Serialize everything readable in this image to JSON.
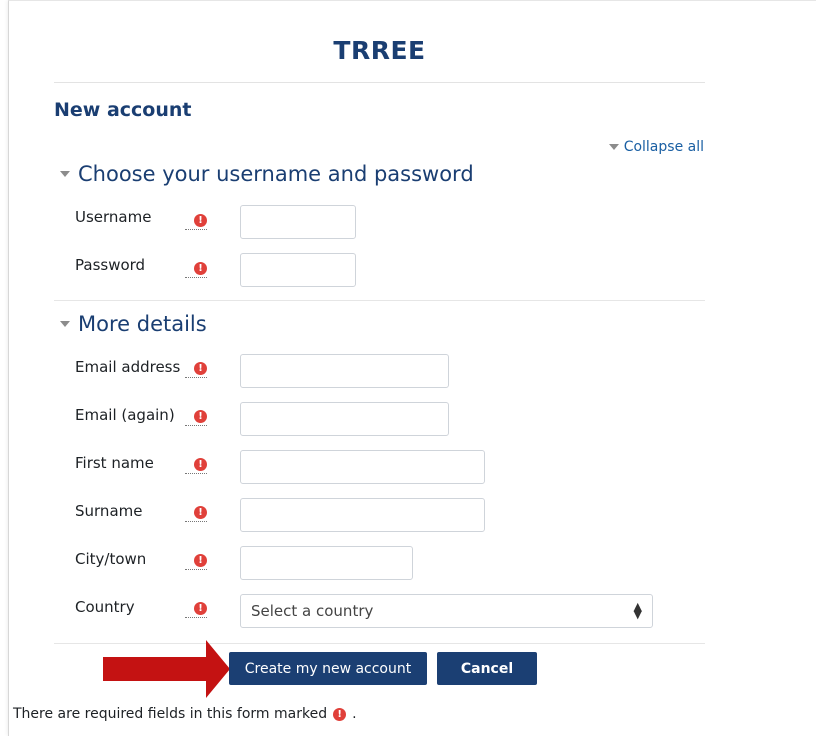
{
  "site": {
    "title": "TRREE"
  },
  "page": {
    "heading": "New account",
    "collapse_all": "Collapse all"
  },
  "sections": {
    "credentials": {
      "title": "Choose your username and password"
    },
    "details": {
      "title": "More details"
    }
  },
  "fields": {
    "username": {
      "label": "Username",
      "value": ""
    },
    "password": {
      "label": "Password",
      "value": ""
    },
    "email": {
      "label": "Email address",
      "value": ""
    },
    "email2": {
      "label": "Email (again)",
      "value": ""
    },
    "firstname": {
      "label": "First name",
      "value": ""
    },
    "surname": {
      "label": "Surname",
      "value": ""
    },
    "city": {
      "label": "City/town",
      "value": ""
    },
    "country": {
      "label": "Country",
      "selected": "Select a country"
    }
  },
  "buttons": {
    "submit": "Create my new account",
    "cancel": "Cancel"
  },
  "footer": {
    "required_note": "There are required fields in this form marked",
    "period": "."
  },
  "icons": {
    "required": "exclamation-circle-icon",
    "collapse": "triangle-down-icon",
    "annotation": "red-arrow-icon"
  },
  "colors": {
    "brand": "#1a3e72",
    "button": "#1b3f73",
    "required": "#e0403a",
    "annotation_arrow": "#c41212"
  }
}
